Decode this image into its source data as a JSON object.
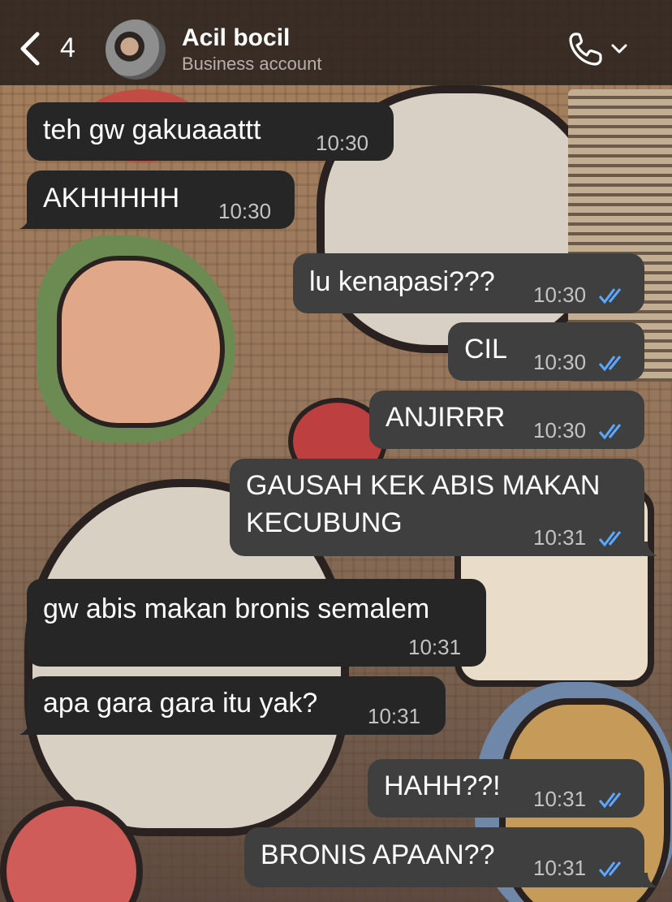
{
  "header": {
    "back_count": "4",
    "title": "Acil bocil",
    "subtitle": "Business account",
    "icons": {
      "back": "chevron-left-icon",
      "call": "phone-icon",
      "call_menu": "chevron-down-icon"
    }
  },
  "colors": {
    "header_bg": "#2a221e",
    "incoming_bubble": "#262626",
    "outgoing_bubble": "#3f3f3f",
    "tick_blue": "#5aa8ff",
    "time_gray": "#c3c3c3"
  },
  "messages": [
    {
      "direction": "in",
      "text": "teh gw gakuaaattt",
      "time": "10:30"
    },
    {
      "direction": "in",
      "text": "AKHHHHH",
      "time": "10:30"
    },
    {
      "direction": "out",
      "text": "lu kenapasi???",
      "time": "10:30",
      "status": "read"
    },
    {
      "direction": "out",
      "text": "CIL",
      "time": "10:30",
      "status": "read"
    },
    {
      "direction": "out",
      "text": "ANJIRRR",
      "time": "10:30",
      "status": "read"
    },
    {
      "direction": "out",
      "text": "GAUSAH KEK ABIS MAKAN\nKECUBUNG",
      "time": "10:31",
      "status": "read"
    },
    {
      "direction": "in",
      "text": "gw abis makan bronis semalem",
      "time": "10:31"
    },
    {
      "direction": "in",
      "text": "apa gara gara itu yak?",
      "time": "10:31"
    },
    {
      "direction": "out",
      "text": "HAHH??!",
      "time": "10:31",
      "status": "read"
    },
    {
      "direction": "out",
      "text": "BRONIS APAAN??",
      "time": "10:31",
      "status": "read"
    }
  ]
}
